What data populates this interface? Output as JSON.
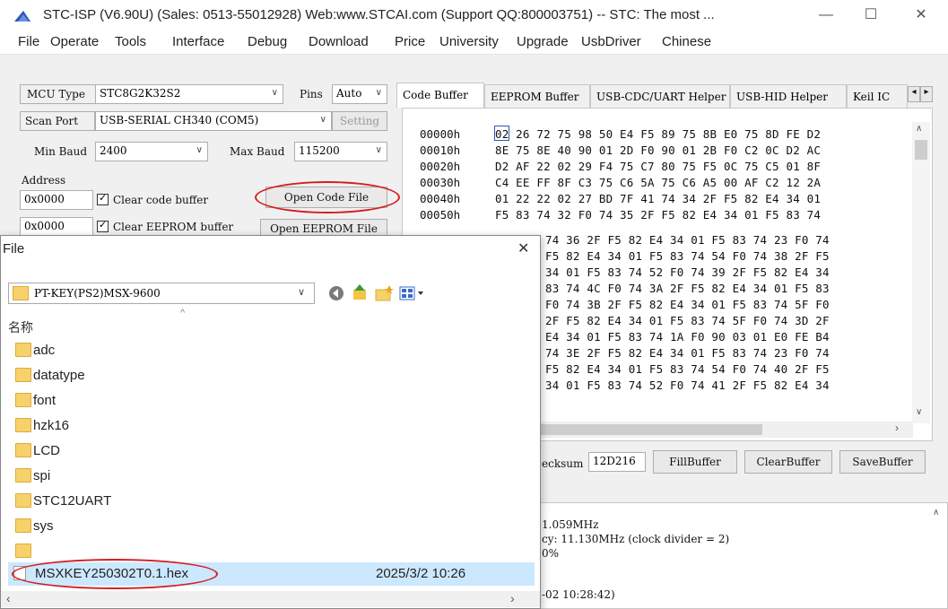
{
  "window": {
    "title": "STC-ISP (V6.90U) (Sales: 0513-55012928) Web:www.STCAI.com  (Support QQ:800003751) -- STC: The most ...",
    "minimize": "—",
    "maximize": "☐",
    "close": "✕"
  },
  "menu": [
    "File",
    "Operate",
    "Tools",
    "Interface",
    "Debug",
    "Download",
    "Price",
    "University",
    "Upgrade",
    "UsbDriver",
    "Chinese"
  ],
  "left": {
    "mcu_type_label": "MCU Type",
    "mcu_type_value": "STC8G2K32S2",
    "pins_label": "Pins",
    "pins_value": "Auto",
    "scan_port_label": "Scan Port",
    "scan_port_value": "USB-SERIAL CH340 (COM5)",
    "setting_label": "Setting",
    "min_baud_label": "Min Baud",
    "min_baud_value": "2400",
    "max_baud_label": "Max Baud",
    "max_baud_value": "115200",
    "address_label": "Address",
    "code_addr": "0x0000",
    "clear_code_label": "Clear code buffer",
    "open_code_file": "Open Code File",
    "eeprom_addr": "0x0000",
    "clear_eeprom_label": "Clear EEPROM buffer",
    "open_eeprom_file": "Open EEPROM File"
  },
  "tabs": [
    "Code Buffer",
    "EEPROM Buffer",
    "USB-CDC/UART Helper",
    "USB-HID Helper",
    "Keil IC"
  ],
  "tab_nav": {
    "prev": "◂",
    "next": "▸"
  },
  "hex": {
    "addresses": [
      "00000h",
      "00010h",
      "00020h",
      "00030h",
      "00040h",
      "00050h"
    ],
    "rows": [
      "02 26 72 75 98 50 E4 F5 89 75 8B E0 75 8D FE D2",
      "8E 75 8E 40 90 01 2D F0 90 01 2B F0 C2 0C D2 AC",
      "D2 AF 22 02 29 F4 75 C7 80 75 F5 0C 75 C5 01 8F",
      "C4 EE FF 8F C3 75 C6 5A 75 C6 A5 00 AF C2 12 2A",
      "01 22 22 02 27 BD 7F 41 74 34 2F F5 82 E4 34 01",
      "F5 83 74 32 F0 74 35 2F F5 82 E4 34 01 F5 83 74"
    ],
    "partial_rows": [
      "74 36 2F F5 82 E4 34 01 F5 83 74 23 F0 74",
      "F5 82 E4 34 01 F5 83 74 54 F0 74 38 2F F5",
      "34 01 F5 83 74 52 F0 74 39 2F F5 82 E4 34",
      "83 74 4C F0 74 3A 2F F5 82 E4 34 01 F5 83",
      "F0 74 3B 2F F5 82 E4 34 01 F5 83 74 5F F0",
      "2F F5 82 E4 34 01 F5 83 74 5F F0 74 3D 2F",
      "E4 34 01 F5 83 74 1A F0 90 03 01 E0 FE B4",
      "74 3E 2F F5 82 E4 34 01 F5 83 74 23 F0 74",
      "F5 82 E4 34 01 F5 83 74 54 F0 74 40 2F F5",
      "34 01 F5 83 74 52 F0 74 41 2F F5 82 E4 34"
    ]
  },
  "bottom": {
    "checksum_label": "ecksum",
    "checksum_value": "12D216",
    "fill_buffer": "FillBuffer",
    "clear_buffer": "ClearBuffer",
    "save_buffer": "SaveBuffer"
  },
  "log": {
    "line1": "1.059MHz",
    "line2": "cy: 11.130MHz (clock divider = 2)",
    "line3": "0%",
    "line4": "-02 10:28:42)"
  },
  "dialog": {
    "title": "File",
    "close": "✕",
    "path": "PT-KEY(PS2)MSX-9600",
    "column_name": "名称",
    "folders": [
      "adc",
      "datatype",
      "font",
      "hzk16",
      "LCD",
      "spi",
      "STC12UART",
      "sys"
    ],
    "file_name": "MSXKEY250302T0.1.hex",
    "file_date": "2025/3/2 10:26"
  },
  "colors": {
    "highlight_red": "#d41f1f",
    "selected_row": "#cce8ff"
  }
}
